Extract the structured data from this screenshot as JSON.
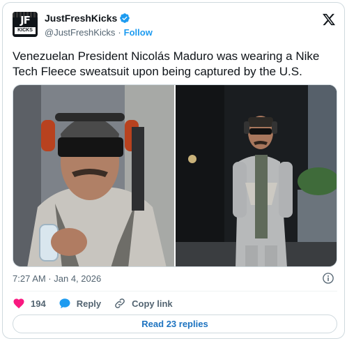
{
  "author": {
    "name": "JustFreshKicks",
    "handle": "@JustFreshKicks",
    "separator": "·",
    "follow_label": "Follow",
    "avatar_text_top": "JF",
    "avatar_text_bottom": "KICKS"
  },
  "tweet": {
    "text": "Venezuelan President Nicolás Maduro was wearing a Nike Tech Fleece sweatsuit upon being captured by the U.S.",
    "timestamp": "7:27 AM · Jan 4, 2026"
  },
  "actions": {
    "like_count": "194",
    "reply_label": "Reply",
    "copy_link_label": "Copy link"
  },
  "read_replies_label": "Read 23 replies",
  "colors": {
    "accent": "#1d9bf0",
    "like": "#f91880",
    "text_secondary": "#536471",
    "border": "#cfd9de"
  },
  "icons": [
    "verified-badge-icon",
    "x-logo-icon",
    "info-icon",
    "heart-icon",
    "reply-bubble-icon",
    "link-icon"
  ]
}
